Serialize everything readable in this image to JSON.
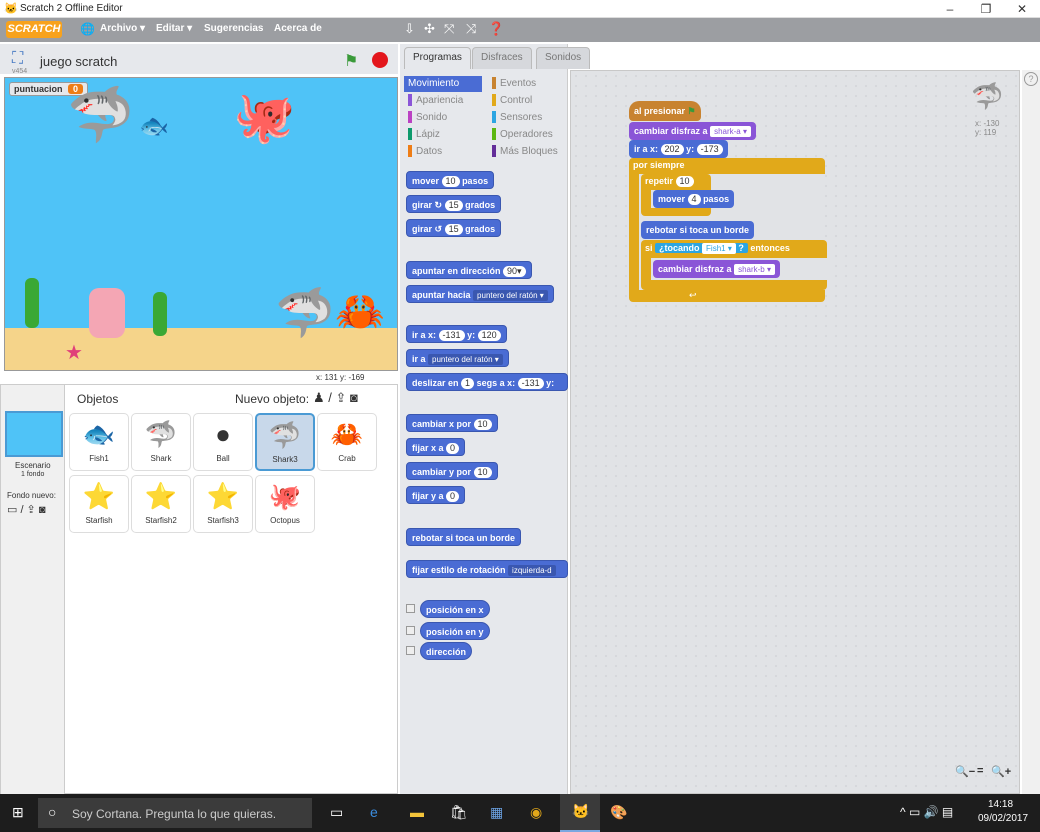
{
  "window": {
    "title": "Scratch 2 Offline Editor",
    "min": "–",
    "max": "❐",
    "close": "✕"
  },
  "menu": {
    "logo": "SCRATCH",
    "items": [
      "Archivo ▾",
      "Editar ▾",
      "Sugerencias",
      "Acerca de"
    ]
  },
  "stage": {
    "project_name": "juego scratch",
    "version": "v454",
    "variable_label": "puntuacion",
    "variable_value": "0",
    "coords": "x: 131  y: -169"
  },
  "tabs": [
    "Programas",
    "Disfraces",
    "Sonidos"
  ],
  "categories": [
    {
      "name": "Movimiento",
      "color": "#4a6cd4"
    },
    {
      "name": "Eventos",
      "color": "#c88330"
    },
    {
      "name": "Apariencia",
      "color": "#8a55d7"
    },
    {
      "name": "Control",
      "color": "#e1a91a"
    },
    {
      "name": "Sonido",
      "color": "#bb42c3"
    },
    {
      "name": "Sensores",
      "color": "#2ca5e2"
    },
    {
      "name": "Lápiz",
      "color": "#0e9a6c"
    },
    {
      "name": "Operadores",
      "color": "#5cb712"
    },
    {
      "name": "Datos",
      "color": "#ee7d16"
    },
    {
      "name": "Más Bloques",
      "color": "#632d99"
    }
  ],
  "palette": {
    "b1": [
      "mover",
      "10",
      "pasos"
    ],
    "b2": [
      "girar ↻",
      "15",
      "grados"
    ],
    "b3": [
      "girar ↺",
      "15",
      "grados"
    ],
    "b4": [
      "apuntar en dirección",
      "90▾"
    ],
    "b5": [
      "apuntar hacia",
      "puntero del ratón ▾"
    ],
    "b6": [
      "ir a x:",
      "-131",
      "y:",
      "120"
    ],
    "b7": [
      "ir a",
      "puntero del ratón ▾"
    ],
    "b8": [
      "deslizar en",
      "1",
      "segs a x:",
      "-131",
      "y:"
    ],
    "b9": [
      "cambiar x por",
      "10"
    ],
    "b10": [
      "fijar x a",
      "0"
    ],
    "b11": [
      "cambiar y por",
      "10"
    ],
    "b12": [
      "fijar y a",
      "0"
    ],
    "b13": "rebotar si toca un borde",
    "b14": [
      "fijar estilo de rotación",
      "izquierda-d"
    ],
    "r1": "posición en x",
    "r2": "posición en y",
    "r3": "dirección"
  },
  "script": {
    "hat": "al presionar",
    "costume": [
      "cambiar disfraz a",
      "shark-a ▾"
    ],
    "goto": [
      "ir a x:",
      "202",
      "y:",
      "-173"
    ],
    "forever": "por siempre",
    "repeat": [
      "repetir",
      "10"
    ],
    "move": [
      "mover",
      "4",
      "pasos"
    ],
    "bounce": "rebotar si toca un borde",
    "if": [
      "si",
      "¿tocando",
      "Fish1 ▾",
      "?",
      "entonces"
    ],
    "costume2": [
      "cambiar disfraz a",
      "shark-b ▾"
    ],
    "sprite_x": "x: -130",
    "sprite_y": "y: 119"
  },
  "sprites": {
    "header": "Objetos",
    "new": "Nuevo objeto:",
    "stage_label": "Escenario",
    "stage_sub": "1 fondo",
    "new_bg": "Fondo nuevo:",
    "items": [
      {
        "name": "Fish1",
        "glyph": "🐟"
      },
      {
        "name": "Shark",
        "glyph": "🦈"
      },
      {
        "name": "Ball",
        "glyph": "●"
      },
      {
        "name": "Shark3",
        "glyph": "🦈"
      },
      {
        "name": "Crab",
        "glyph": "🦀"
      },
      {
        "name": "Starfish",
        "glyph": "⭐"
      },
      {
        "name": "Starfish2",
        "glyph": "⭐"
      },
      {
        "name": "Starfish3",
        "glyph": "⭐"
      },
      {
        "name": "Octopus",
        "glyph": "🐙"
      }
    ]
  },
  "taskbar": {
    "search": "Soy Cortana. Pregunta lo que quieras.",
    "time": "14:18",
    "date": "09/02/2017"
  },
  "zoom": {
    "out": "🔍−",
    "reset": "=",
    "in": "🔍+"
  }
}
